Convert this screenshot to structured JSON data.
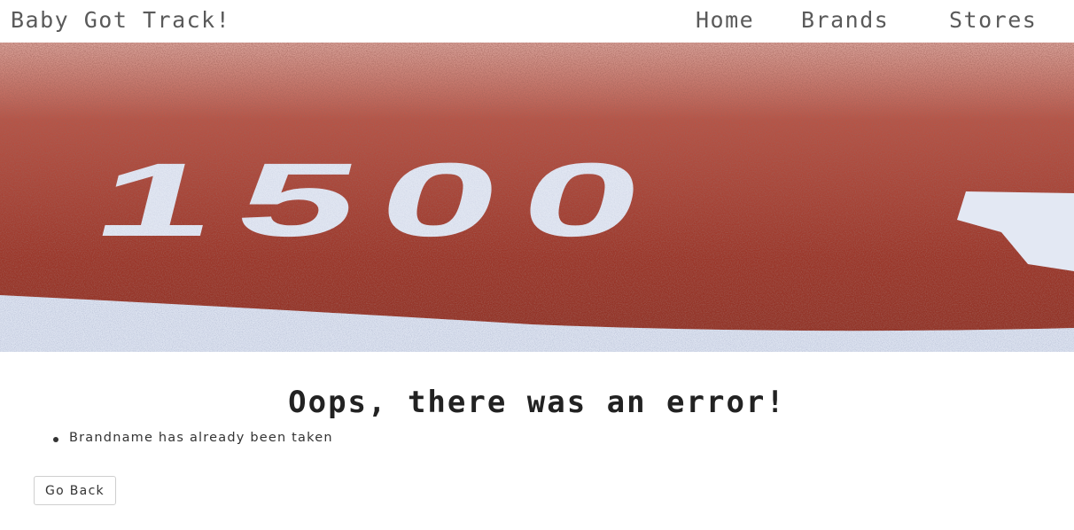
{
  "navbar": {
    "brand": "Baby Got Track!",
    "links": [
      "Home",
      "Brands",
      "Stores"
    ]
  },
  "hero": {
    "painted_number": "1500",
    "colors": {
      "track": "#a23a2c",
      "paint": "#dfe4f0"
    }
  },
  "error": {
    "title": "Oops, there was an error!",
    "messages": [
      "Brandname has already been taken"
    ]
  },
  "actions": {
    "go_back_label": "Go Back"
  }
}
